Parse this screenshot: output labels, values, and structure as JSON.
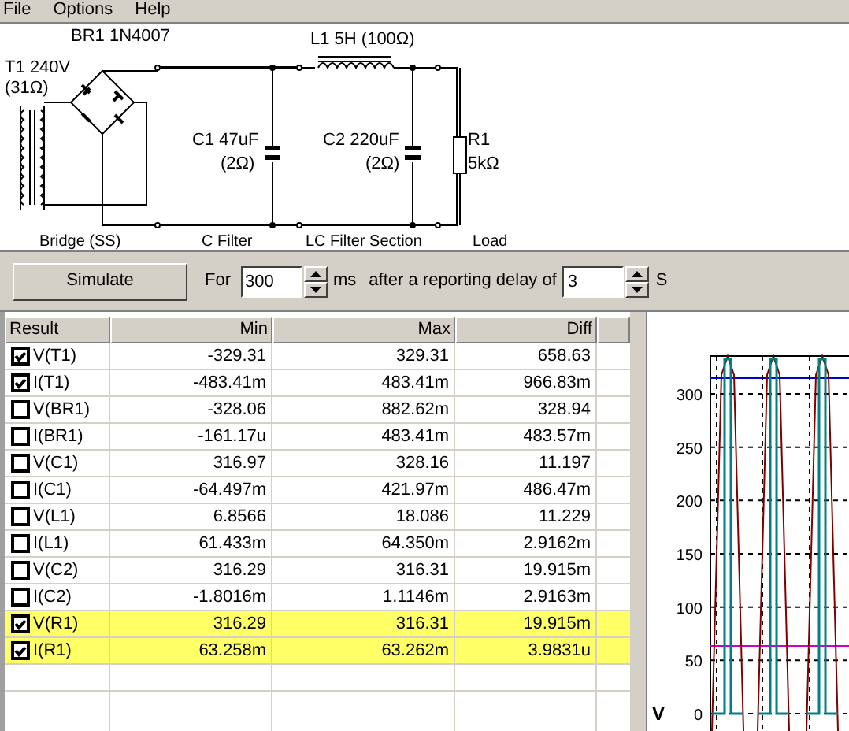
{
  "menu": [
    "File",
    "Options",
    "Help"
  ],
  "schematic": {
    "bridge_label": "BR1 1N4007",
    "transformer_label": "T1 240V",
    "transformer_resistance": "(31Ω)",
    "inductor_label": "L1 5H (100Ω)",
    "c1_label": "C1 47uF",
    "c1_resistance": "(2Ω)",
    "c2_label": "C2 220uF",
    "c2_resistance": "(2Ω)",
    "r1_label": "R1",
    "r1_value": "5kΩ",
    "sections": [
      "Bridge (SS)",
      "C Filter",
      "LC Filter Section",
      "Load"
    ]
  },
  "toolbar": {
    "button": "Simulate",
    "for_label": "For",
    "duration": "300",
    "duration_unit": "ms",
    "delay_label": "after a reporting delay of",
    "delay": "3",
    "delay_unit": "S"
  },
  "table": {
    "columns": [
      "Result",
      "Min",
      "Max",
      "Diff"
    ],
    "rows": [
      {
        "name": "V(T1)",
        "checked": true,
        "highlighted": false,
        "min": "-329.31",
        "max": "329.31",
        "diff": "658.63"
      },
      {
        "name": "I(T1)",
        "checked": true,
        "highlighted": false,
        "min": "-483.41m",
        "max": "483.41m",
        "diff": "966.83m"
      },
      {
        "name": "V(BR1)",
        "checked": false,
        "highlighted": false,
        "min": "-328.06",
        "max": "882.62m",
        "diff": "328.94"
      },
      {
        "name": "I(BR1)",
        "checked": false,
        "highlighted": false,
        "min": "-161.17u",
        "max": "483.41m",
        "diff": "483.57m"
      },
      {
        "name": "V(C1)",
        "checked": false,
        "highlighted": false,
        "min": "316.97",
        "max": "328.16",
        "diff": "11.197"
      },
      {
        "name": "I(C1)",
        "checked": false,
        "highlighted": false,
        "min": "-64.497m",
        "max": "421.97m",
        "diff": "486.47m"
      },
      {
        "name": "V(L1)",
        "checked": false,
        "highlighted": false,
        "min": "6.8566",
        "max": "18.086",
        "diff": "11.229"
      },
      {
        "name": "I(L1)",
        "checked": false,
        "highlighted": false,
        "min": "61.433m",
        "max": "64.350m",
        "diff": "2.9162m"
      },
      {
        "name": "V(C2)",
        "checked": false,
        "highlighted": false,
        "min": "316.29",
        "max": "316.31",
        "diff": "19.915m"
      },
      {
        "name": "I(C2)",
        "checked": false,
        "highlighted": false,
        "min": "-1.8016m",
        "max": "1.1146m",
        "diff": "2.9163m"
      },
      {
        "name": "V(R1)",
        "checked": true,
        "highlighted": true,
        "min": "316.29",
        "max": "316.31",
        "diff": "19.915m"
      },
      {
        "name": "I(R1)",
        "checked": true,
        "highlighted": true,
        "min": "63.258m",
        "max": "63.262m",
        "diff": "3.9831u"
      }
    ]
  },
  "plot": {
    "unit": "V",
    "y_tick_labels": [
      "300",
      "250",
      "200",
      "150",
      "100",
      "50",
      "0"
    ]
  }
}
